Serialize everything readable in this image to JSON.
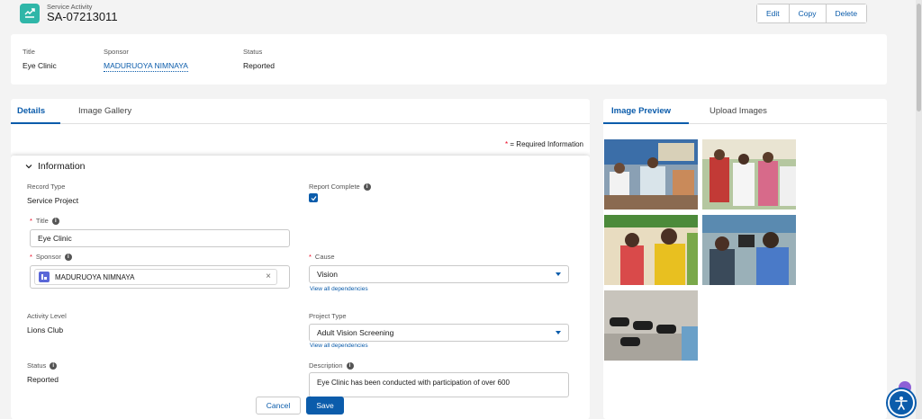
{
  "header": {
    "object_label": "Service Activity",
    "record_name": "SA-07213011",
    "actions": [
      "Edit",
      "Copy",
      "Delete"
    ]
  },
  "highlights": [
    {
      "label": "Title",
      "value": "Eye Clinic"
    },
    {
      "label": "Sponsor",
      "value": "MADURUOYA NIMNAYA"
    },
    {
      "label": "Status",
      "value": "Reported"
    }
  ],
  "left_tabs": [
    "Details",
    "Image Gallery"
  ],
  "required_info": "= Required Information",
  "form": {
    "section_title": "Information",
    "record_type_label": "Record Type",
    "record_type_value": "Service Project",
    "report_complete_label": "Report Complete",
    "report_complete_checked": true,
    "title_label": "Title",
    "title_value": "Eye Clinic",
    "sponsor_label": "Sponsor",
    "sponsor_value": "MADURUOYA NIMNAYA",
    "cause_label": "Cause",
    "cause_value": "Vision",
    "view_dependencies": "View all dependencies",
    "activity_level_label": "Activity Level",
    "activity_level_value": "Lions Club",
    "project_type_label": "Project Type",
    "project_type_value": "Adult Vision Screening",
    "status_label": "Status",
    "status_value": "Reported",
    "description_label": "Description",
    "description_value": "Eye Clinic has been conducted with participation of over 600"
  },
  "footer": {
    "cancel": "Cancel",
    "save": "Save"
  },
  "right_tabs": [
    "Image Preview",
    "Upload Images"
  ],
  "colors": {
    "brand": "#0b5cab",
    "required": "#ea001e",
    "header_icon": "#2fb6a8"
  }
}
